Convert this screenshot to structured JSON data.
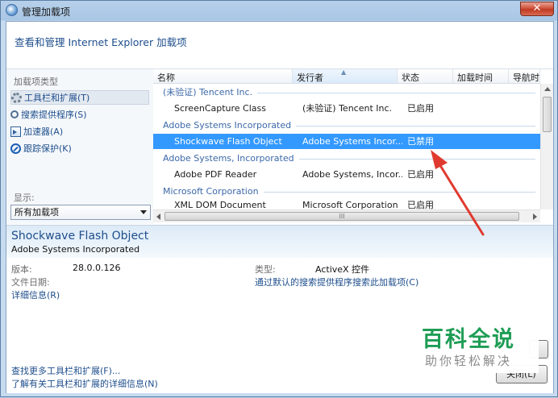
{
  "window": {
    "title": "管理加载项",
    "close_symbol": "✕"
  },
  "header": {
    "text": "查看和管理 Internet Explorer 加载项"
  },
  "left_pane": {
    "types_label": "加载项类型",
    "types": [
      {
        "label": "工具栏和扩展(T)",
        "icon": "gear-icon",
        "selected": true
      },
      {
        "label": "搜索提供程序(S)",
        "icon": "search-icon",
        "selected": false
      },
      {
        "label": "加速器(A)",
        "icon": "accelerator-icon",
        "selected": false
      },
      {
        "label": "跟踪保护(K)",
        "icon": "tracking-protection-icon",
        "selected": false
      }
    ],
    "show_label": "显示:",
    "show_value": "所有加载项"
  },
  "list": {
    "columns": [
      "名称",
      "发行者",
      "状态",
      "加载时间",
      "导航时间"
    ],
    "groups": [
      {
        "name": "(未验证) Tencent Inc.",
        "rows": [
          {
            "name": "ScreenCapture Class",
            "publisher": "(未验证) Tencent Inc.",
            "status": "已启用"
          }
        ]
      },
      {
        "name": "Adobe Systems Incorporated",
        "rows": [
          {
            "name": "Shockwave Flash Object",
            "publisher": "Adobe Systems Incor...",
            "status": "已禁用",
            "selected": true
          }
        ]
      },
      {
        "name": "Adobe Systems, Incorporated",
        "rows": [
          {
            "name": "Adobe PDF Reader",
            "publisher": "Adobe Systems, Incor...",
            "status": "已启用"
          }
        ]
      },
      {
        "name": "Microsoft Corporation",
        "rows": [
          {
            "name": "XML DOM Document",
            "publisher": "Microsoft Corporation",
            "status": "已启用"
          }
        ]
      }
    ],
    "hscroll_grip": "III"
  },
  "details": {
    "title": "Shockwave Flash Object",
    "subtitle": "Adobe Systems Incorporated",
    "version_label": "版本:",
    "version_value": "28.0.0.126",
    "file_date_label": "文件日期:",
    "more_info": "详细信息(R)",
    "type_label": "类型:",
    "type_value": "ActiveX 控件",
    "search_link": "通过默认的搜索提供程序搜索此加载项(C)"
  },
  "footer": {
    "link1": "查找更多工具栏和扩展(F)...",
    "link2": "了解有关工具栏和扩展的详细信息(N)",
    "close_button": "关闭(L)"
  },
  "watermark": {
    "main": "百科全说",
    "sub": "助你轻松解决"
  },
  "colors": {
    "accent": "#1e4e8c",
    "selection": "#3399ff",
    "annotation_arrow": "#e03a2f",
    "watermark_green": "#1f9d55"
  }
}
